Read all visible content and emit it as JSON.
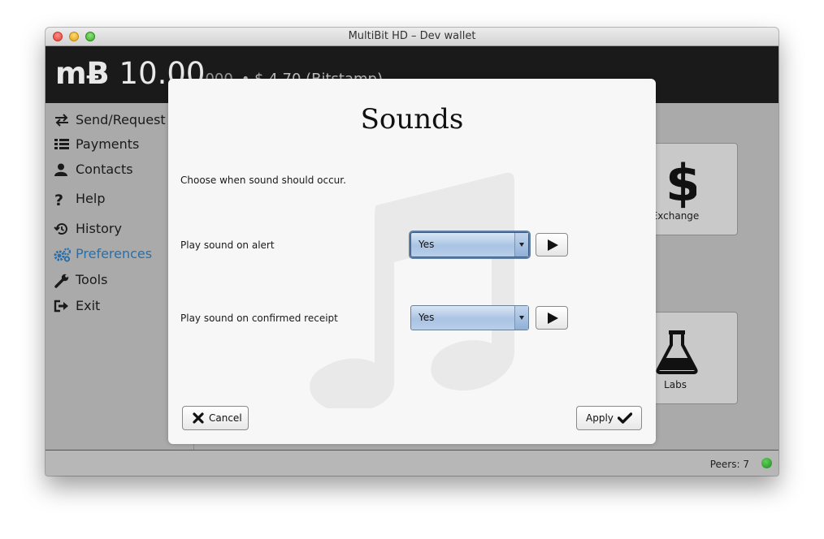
{
  "window": {
    "title": "MultiBit HD – Dev wallet"
  },
  "header": {
    "balance_symbol": "mɃ",
    "balance_major": " 10.00",
    "balance_minor": "000",
    "fiat_text": "•  $ 4.70 (Bitstamp)"
  },
  "sidebar": {
    "items": [
      {
        "label": "Send/Request",
        "icon": "exchange-arrows-icon"
      },
      {
        "label": "Payments",
        "icon": "list-icon"
      },
      {
        "label": "Contacts",
        "icon": "user-icon"
      },
      {
        "label": "Help",
        "icon": "question-icon"
      },
      {
        "label": "History",
        "icon": "history-icon"
      },
      {
        "label": "Preferences",
        "icon": "gears-icon",
        "active": true
      },
      {
        "label": "Tools",
        "icon": "wrench-icon"
      },
      {
        "label": "Exit",
        "icon": "sign-out-icon"
      }
    ],
    "active_color": "#2a6fa8"
  },
  "tiles": {
    "exchange_label": "Exchange",
    "labs_label": "Labs"
  },
  "status": {
    "peers_text": "Peers: 7",
    "peer_color": "#2a9a2a"
  },
  "dialog": {
    "title": "Sounds",
    "instructions": "Choose when sound should occur.",
    "alert_label": "Play sound on alert",
    "alert_value": "Yes",
    "receipt_label": "Play sound on confirmed receipt",
    "receipt_value": "Yes",
    "cancel_label": "Cancel",
    "apply_label": "Apply"
  }
}
